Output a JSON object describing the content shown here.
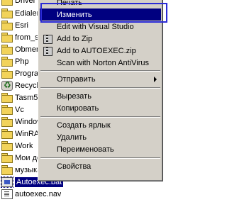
{
  "file_list": {
    "rows": [
      {
        "name": "Driver",
        "icon": "folder-icon"
      },
      {
        "name": "Edialer",
        "icon": "folder-icon"
      },
      {
        "name": "Esri",
        "icon": "folder-icon"
      },
      {
        "name": "from_se",
        "icon": "folder-icon"
      },
      {
        "name": "Obmen",
        "icon": "folder-icon"
      },
      {
        "name": "Php",
        "icon": "folder-icon"
      },
      {
        "name": "Program",
        "icon": "folder-icon"
      },
      {
        "name": "Recycle",
        "icon": "recycle-bin-icon"
      },
      {
        "name": "Tasm50",
        "icon": "folder-icon"
      },
      {
        "name": "Vc",
        "icon": "folder-icon"
      },
      {
        "name": "Window",
        "icon": "folder-icon"
      },
      {
        "name": "WinRAR",
        "icon": "folder-icon"
      },
      {
        "name": "Work",
        "icon": "folder-icon"
      },
      {
        "name": "Мои до",
        "icon": "folder-icon"
      },
      {
        "name": "музыка",
        "icon": "folder-icon"
      },
      {
        "name": "Autoexec.bat",
        "icon": "bat-file-icon",
        "selected": true
      },
      {
        "name": "autoexec.nav",
        "icon": "text-file-icon"
      }
    ]
  },
  "context_menu": {
    "items": {
      "print": "Печать",
      "edit": "Изменить",
      "edit_vs": "Edit with Visual Studio",
      "add_zip": "Add to Zip",
      "add_autoexec_zip": "Add to AUTOEXEC.zip",
      "scan_nav": "Scan with Norton AntiVirus",
      "send_to": "Отправить",
      "cut": "Вырезать",
      "copy": "Копировать",
      "create_shortcut": "Создать ярлык",
      "delete": "Удалить",
      "rename": "Переименовать",
      "properties": "Свойства"
    },
    "highlighted_item": "Изменить",
    "highlight_color": "#000080",
    "frame_color": "#2b2bd6"
  }
}
